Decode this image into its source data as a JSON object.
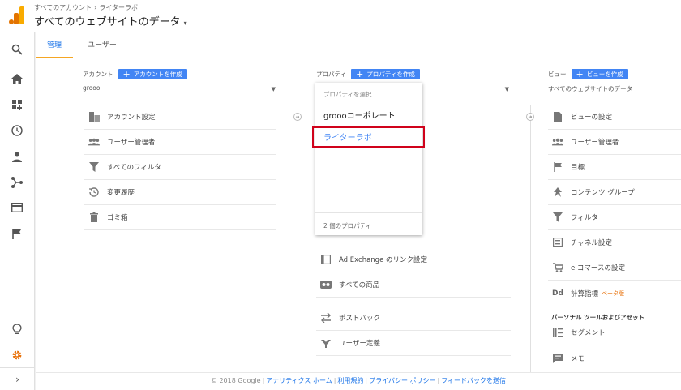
{
  "header": {
    "breadcrumb": [
      "すべてのアカウント",
      "ライターラボ"
    ],
    "breadcrumb_sep": "›",
    "title": "すべてのウェブサイトのデータ",
    "title_caret": "▾"
  },
  "nav": {
    "icons": [
      "search-icon",
      "home-icon",
      "customization-icon",
      "realtime-icon",
      "audience-icon",
      "acquisition-icon",
      "behavior-icon",
      "conversions-icon",
      "discover-icon",
      "admin-gear-icon",
      "expand-icon"
    ],
    "expand_glyph": "›"
  },
  "tabs": [
    {
      "label": "管理",
      "active": true
    },
    {
      "label": "ユーザー",
      "active": false
    }
  ],
  "account": {
    "label": "アカウント",
    "create": "アカウントを作成",
    "selected": "grooo",
    "items": [
      {
        "icon": "account-settings-icon",
        "label": "アカウント設定"
      },
      {
        "icon": "user-management-icon",
        "label": "ユーザー管理者"
      },
      {
        "icon": "filter-icon",
        "label": "すべてのフィルタ"
      },
      {
        "icon": "history-icon",
        "label": "変更履歴"
      },
      {
        "icon": "trash-icon",
        "label": "ゴミ箱"
      }
    ]
  },
  "property": {
    "label": "プロパティ",
    "create": "プロパティを作成",
    "items": [
      {
        "icon": "adexchange-icon",
        "label": "Ad Exchange のリンク設定"
      },
      {
        "icon": "products-icon",
        "label": "すべての商品"
      },
      {
        "icon": "postback-icon",
        "label": "ポストバック"
      },
      {
        "icon": "user-definition-icon",
        "label": "ユーザー定義"
      }
    ]
  },
  "dropdown": {
    "header": "プロパティを選択",
    "options": [
      {
        "label": "groooコーポレート",
        "selected": false
      },
      {
        "label": "ライターラボ",
        "selected": true
      }
    ],
    "footer": "2 個のプロパティ"
  },
  "view": {
    "label": "ビュー",
    "create": "ビューを作成",
    "selected": "すべてのウェブサイトのデータ",
    "items": [
      {
        "icon": "view-settings-icon",
        "label": "ビューの設定"
      },
      {
        "icon": "user-management-icon",
        "label": "ユーザー管理者"
      },
      {
        "icon": "goal-flag-icon",
        "label": "目標"
      },
      {
        "icon": "content-group-icon",
        "label": "コンテンツ グループ"
      },
      {
        "icon": "filter-icon",
        "label": "フィルタ"
      },
      {
        "icon": "channel-settings-icon",
        "label": "チャネル設定"
      },
      {
        "icon": "ecommerce-cart-icon",
        "label": "e コマースの設定"
      },
      {
        "icon": "calculated-metrics-icon",
        "label": "計算指標",
        "badge": "ベータ版"
      }
    ],
    "section": "パーソナル ツールおよびアセット",
    "section_items": [
      {
        "icon": "segment-icon",
        "label": "セグメント"
      },
      {
        "icon": "memo-icon",
        "label": "メモ"
      }
    ]
  },
  "footer": {
    "copyright": "© 2018 Google",
    "links": [
      "アナリティクス ホーム",
      "利用規約",
      "プライバシー ポリシー",
      "フィードバックを送信"
    ]
  },
  "colors": {
    "accent": "#4285f4",
    "tab_underline": "#f5a623",
    "highlight_border": "#d0021b",
    "admin_gear": "#e8710a"
  }
}
